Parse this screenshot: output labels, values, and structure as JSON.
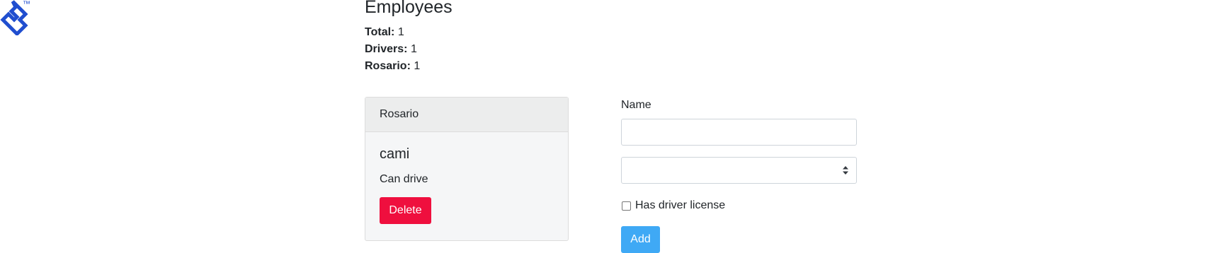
{
  "logo": {
    "icon": "toptal-logo-icon",
    "trademark": "™",
    "color": "#204ecf"
  },
  "header": {
    "title": "Employees"
  },
  "stats": [
    {
      "label": "Total:",
      "value": "1"
    },
    {
      "label": "Drivers:",
      "value": "1"
    },
    {
      "label": "Rosario:",
      "value": "1"
    }
  ],
  "card": {
    "header": "Rosario",
    "employee_name": "cami",
    "status": "Can drive",
    "delete_label": "Delete",
    "delete_color": "#ef0f3e"
  },
  "form": {
    "name_label": "Name",
    "name_value": "",
    "select_value": "",
    "select_icon": "select-arrows-icon",
    "checkbox_label": "Has driver license",
    "checkbox_checked": false,
    "add_label": "Add",
    "add_color": "#3fa9f5"
  }
}
